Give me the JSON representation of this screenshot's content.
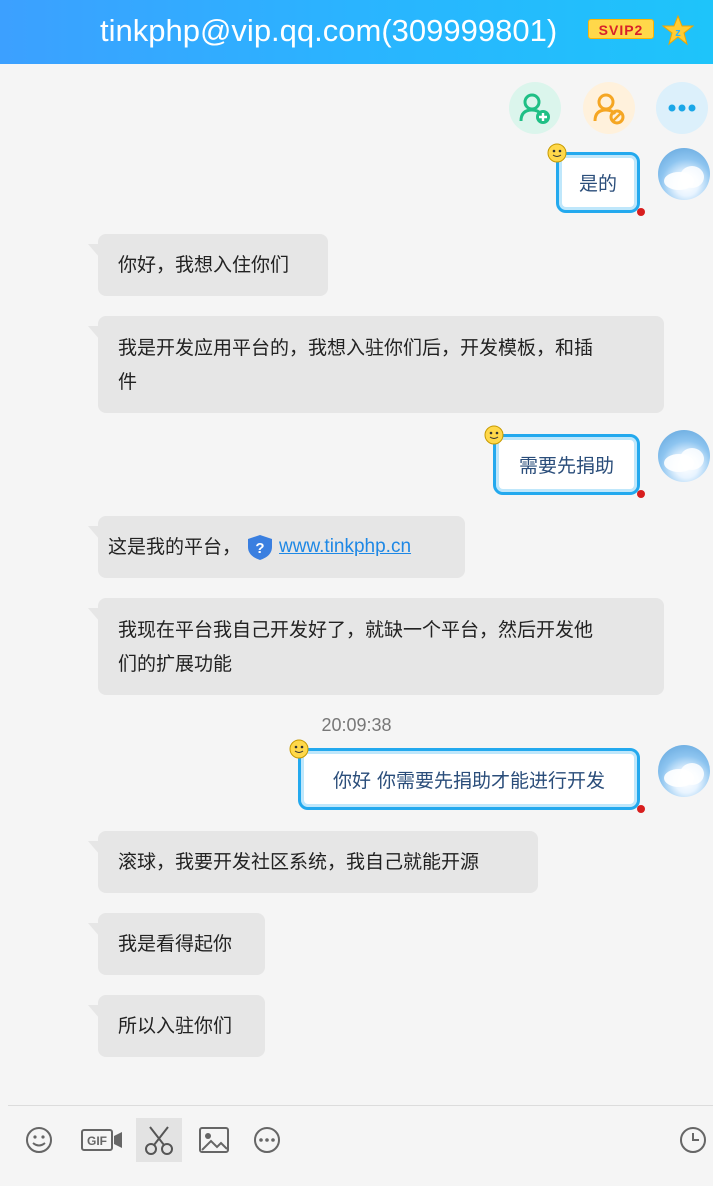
{
  "header": {
    "title": "tinkphp@vip.qq.com(309999801)",
    "badge": "SVIP2",
    "accent": "#2ab4ff"
  },
  "actions": [
    {
      "icon": "add-user-icon"
    },
    {
      "icon": "user-settings-icon"
    },
    {
      "icon": "more-icon"
    }
  ],
  "messages": [
    {
      "side": "out",
      "text": "是的"
    },
    {
      "side": "in",
      "lines": [
        "你好，我想入住你们"
      ]
    },
    {
      "side": "in",
      "lines": [
        "我是开发应用平台的，我想入驻你们后，开发模板，和插",
        "件"
      ]
    },
    {
      "side": "out",
      "text": "需要先捐助"
    },
    {
      "side": "in",
      "prefix": "这是我的平台，",
      "link": "www.tinkphp.cn"
    },
    {
      "side": "in",
      "lines": [
        "我现在平台我自己开发好了，就缺一个平台，然后开发他",
        "们的扩展功能"
      ]
    },
    {
      "side": "time",
      "text": "20:09:38"
    },
    {
      "side": "out",
      "text": "你好 你需要先捐助才能进行开发"
    },
    {
      "side": "in",
      "lines": [
        "滚球，我要开发社区系统，我自己就能开源"
      ]
    },
    {
      "side": "in",
      "lines": [
        "我是看得起你"
      ]
    },
    {
      "side": "in",
      "lines": [
        "所以入驻你们"
      ]
    }
  ],
  "toolbar": {
    "tools": [
      "emoji-icon",
      "gif-icon",
      "screenshot-scissors-icon",
      "image-icon",
      "more-options-icon",
      "history-clock-icon"
    ],
    "gif_label": "GIF"
  }
}
